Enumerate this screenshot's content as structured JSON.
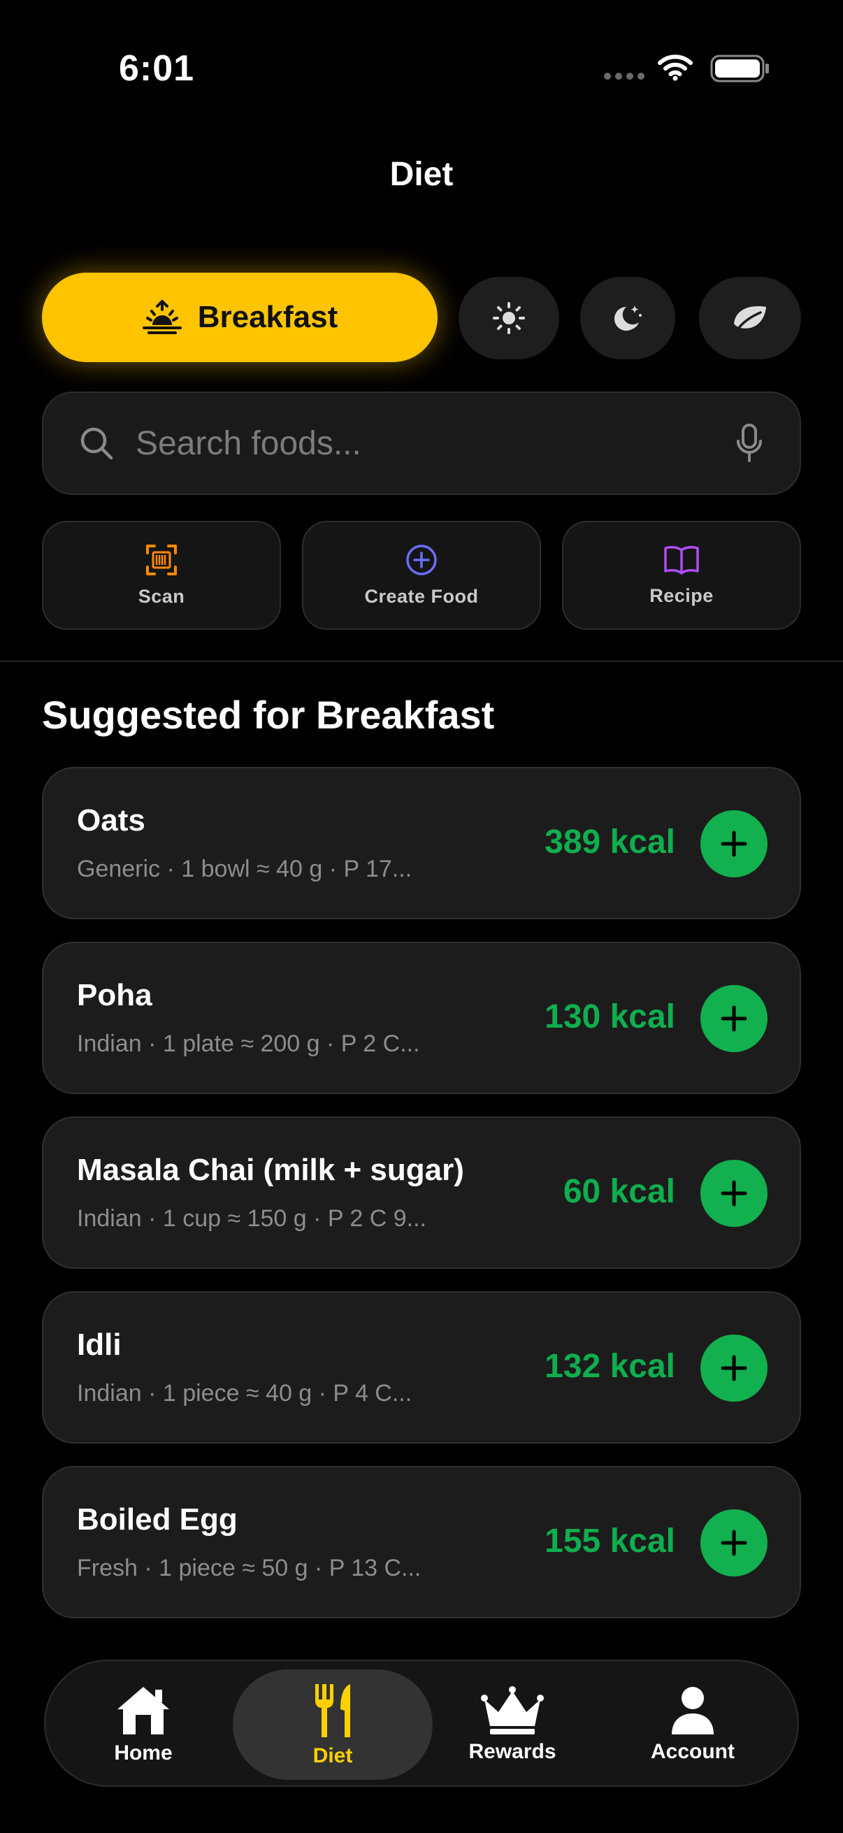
{
  "status_bar": {
    "time": "6:01"
  },
  "header": {
    "title": "Diet"
  },
  "meal_chips": {
    "selected_label": "Breakfast",
    "icons": [
      "sunrise-icon",
      "sun-icon",
      "moon-stars-icon",
      "leaf-icon"
    ]
  },
  "search": {
    "placeholder": "Search foods..."
  },
  "actions": [
    {
      "label": "Scan",
      "icon": "barcode-scan-icon",
      "color": "#FF8A00"
    },
    {
      "label": "Create Food",
      "icon": "plus-circle-icon",
      "color": "#6C6CFF"
    },
    {
      "label": "Recipe",
      "icon": "book-icon",
      "color": "#B34CFF"
    }
  ],
  "section": {
    "title": "Suggested for Breakfast"
  },
  "foods": [
    {
      "name": "Oats",
      "meta": "Generic · 1 bowl ≈ 40 g  ·  P 17...",
      "kcal": "389 kcal"
    },
    {
      "name": "Poha",
      "meta": "Indian · 1 plate ≈ 200 g  ·  P 2 C...",
      "kcal": "130 kcal"
    },
    {
      "name": "Masala Chai (milk + sugar)",
      "meta": "Indian · 1 cup ≈ 150 g  ·  P 2 C 9...",
      "kcal": "60 kcal"
    },
    {
      "name": "Idli",
      "meta": "Indian · 1 piece ≈ 40 g  ·  P 4 C...",
      "kcal": "132 kcal"
    },
    {
      "name": "Boiled Egg",
      "meta": "Fresh · 1 piece ≈ 50 g  ·  P 13 C...",
      "kcal": "155 kcal"
    }
  ],
  "tabs": [
    {
      "label": "Home",
      "icon": "home-icon"
    },
    {
      "label": "Diet",
      "icon": "fork-knife-icon",
      "active": true
    },
    {
      "label": "Rewards",
      "icon": "crown-icon"
    },
    {
      "label": "Account",
      "icon": "person-icon"
    }
  ],
  "colors": {
    "accent": "#FFC400",
    "kcal_green": "#0FAE4E",
    "add_button": "#12B04E",
    "active_tab": "#FFD000"
  }
}
